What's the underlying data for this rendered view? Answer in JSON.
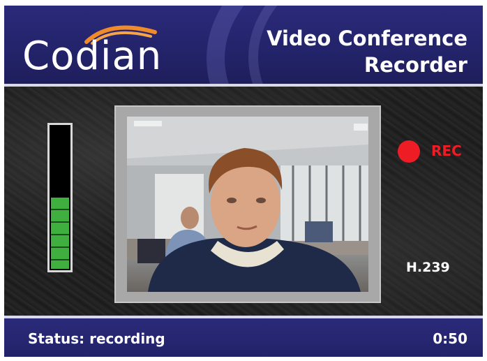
{
  "header": {
    "logo_text": "Codian",
    "title_line1": "Video Conference",
    "title_line2": "Recorder"
  },
  "recording": {
    "indicator_label": "REC",
    "codec": "H.239",
    "audio_level": 0.5
  },
  "status": {
    "text": "Status: recording",
    "elapsed": "0:50"
  },
  "colors": {
    "brand_blue": "#2a2a7a",
    "rec_red": "#ee1c24",
    "meter_green": "#3fb03f",
    "logo_arc_orange": "#f08a2a"
  },
  "icons": {
    "rec_indicator": "red-dot-icon",
    "logo_mark": "codian-arc-icon"
  }
}
